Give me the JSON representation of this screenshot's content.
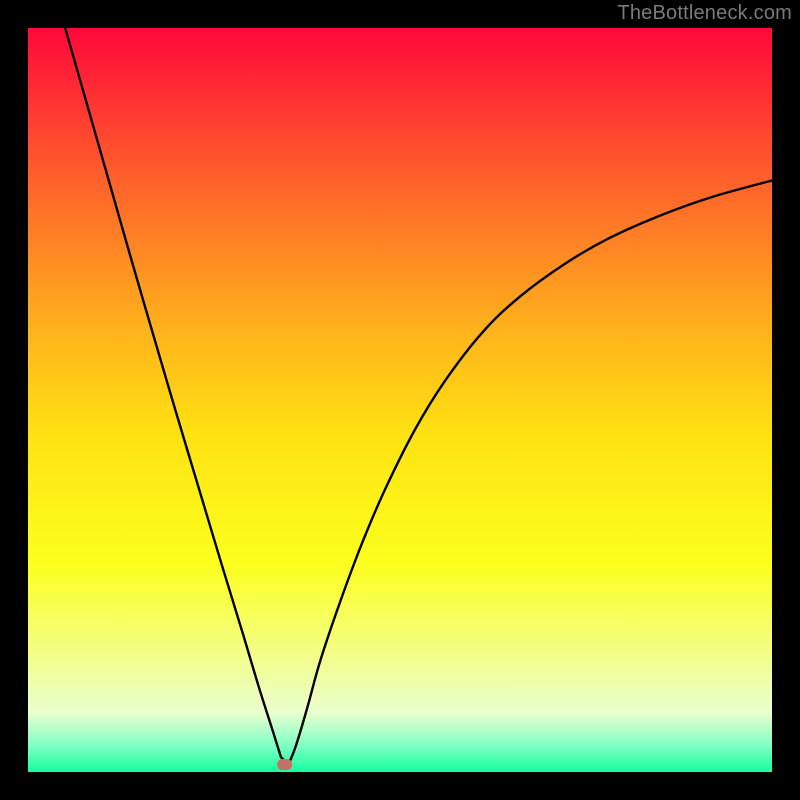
{
  "watermark": "TheBottleneck.com",
  "chart_data": {
    "type": "line",
    "title": "",
    "xlabel": "",
    "ylabel": "",
    "xlim": [
      0,
      100
    ],
    "ylim": [
      0,
      100
    ],
    "x_units": "percent of axis",
    "y_units": "percent of axis (0 = bottom/green, 100 = top/red)",
    "gradient_color_stops": [
      {
        "pos": 0.0,
        "color": "#ff083a"
      },
      {
        "pos": 0.2,
        "color": "#ff5f2b"
      },
      {
        "pos": 0.4,
        "color": "#ffb01c"
      },
      {
        "pos": 0.55,
        "color": "#ffe312"
      },
      {
        "pos": 0.72,
        "color": "#fcff1e"
      },
      {
        "pos": 0.85,
        "color": "#f2ff8f"
      },
      {
        "pos": 0.92,
        "color": "#e9ffcf"
      },
      {
        "pos": 0.965,
        "color": "#7effc4"
      },
      {
        "pos": 1.0,
        "color": "#14ff9e"
      }
    ],
    "feature_marker": {
      "x": 34.5,
      "y": 1.0,
      "color": "#c47066"
    },
    "series": [
      {
        "name": "left-branch",
        "x": [
          5.0,
          8.0,
          11.0,
          14.0,
          17.0,
          20.0,
          23.0,
          26.0,
          29.0,
          31.0,
          33.0,
          34.0
        ],
        "y": [
          100.0,
          89.5,
          79.0,
          68.5,
          58.2,
          48.0,
          38.0,
          28.0,
          18.2,
          11.5,
          5.2,
          2.0
        ]
      },
      {
        "name": "valley-floor",
        "x": [
          34.0,
          35.0
        ],
        "y": [
          2.0,
          1.0
        ]
      },
      {
        "name": "right-branch",
        "x": [
          35.0,
          36.0,
          37.5,
          39.3,
          42.0,
          45.0,
          48.0,
          52.0,
          56.0,
          61.0,
          66.0,
          72.0,
          78.0,
          85.0,
          92.0,
          100.0
        ],
        "y": [
          1.0,
          3.5,
          8.5,
          15.0,
          23.0,
          31.0,
          38.0,
          46.0,
          52.5,
          59.0,
          63.8,
          68.2,
          71.7,
          74.8,
          77.3,
          79.5
        ]
      }
    ]
  }
}
